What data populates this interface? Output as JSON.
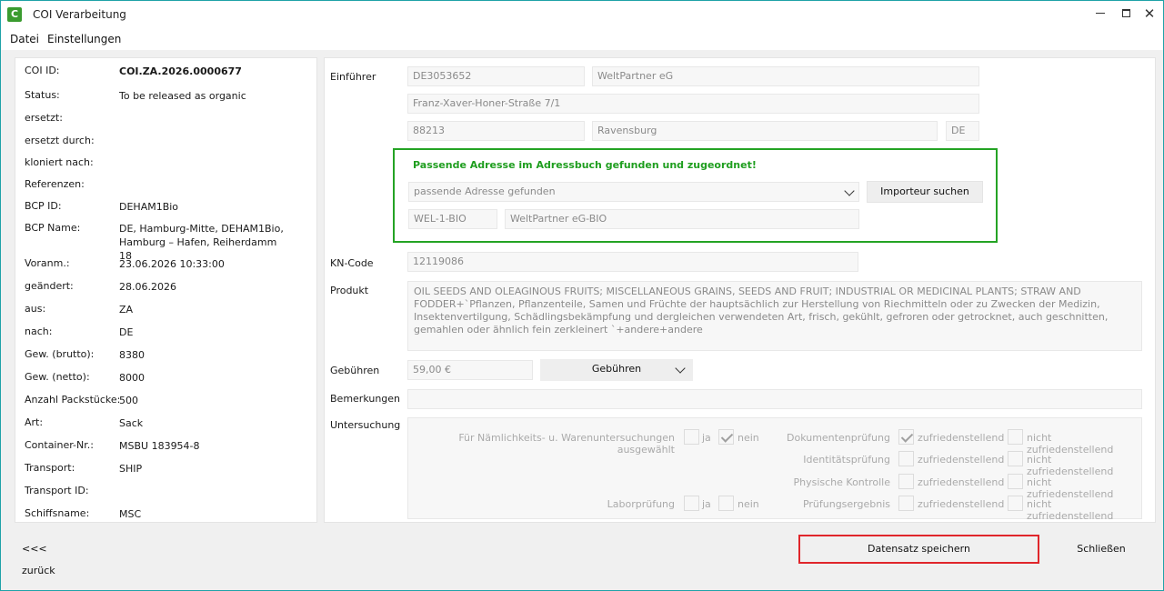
{
  "window": {
    "title": "COI Verarbeitung",
    "icon_letter": "C",
    "minimize": "minimize",
    "maximize": "maximize",
    "close": "✕"
  },
  "menu": {
    "items": [
      "Datei",
      "Einstellungen"
    ]
  },
  "info": {
    "rows": [
      {
        "label": "COI ID:",
        "value": "COI.ZA.2026.0000677"
      },
      {
        "label": "Status:",
        "value": "To be released as organic"
      },
      {
        "label": "ersetzt:",
        "value": ""
      },
      {
        "label": "ersetzt durch:",
        "value": ""
      },
      {
        "label": "kloniert nach:",
        "value": ""
      },
      {
        "label": "Referenzen:",
        "value": ""
      },
      {
        "label": "BCP ID:",
        "value": "DEHAM1Bio"
      },
      {
        "label": "BCP Name:",
        "value": "DE, Hamburg-Mitte, DEHAM1Bio, Hamburg – Hafen, Reiherdamm 18"
      },
      {
        "label": "Voranm.:",
        "value": "23.06.2026 10:33:00"
      },
      {
        "label": "geändert:",
        "value": "28.06.2026"
      },
      {
        "label": "aus:",
        "value": "ZA"
      },
      {
        "label": "nach:",
        "value": "DE"
      },
      {
        "label": "Gew. (brutto):",
        "value": "8380"
      },
      {
        "label": "Gew. (netto):",
        "value": "8000"
      },
      {
        "label": "Anzahl Packstücke:",
        "value": "500"
      },
      {
        "label": "Art:",
        "value": "Sack"
      },
      {
        "label": "Container-Nr.:",
        "value": "MSBU 183954-8"
      },
      {
        "label": "Transport:",
        "value": "SHIP"
      },
      {
        "label": "Transport ID:",
        "value": ""
      },
      {
        "label": "Schiffsname:",
        "value": "MSC"
      }
    ]
  },
  "form": {
    "einfuehrer_label": "Einführer",
    "einfuehrer_id": "DE3053652",
    "einfuehrer_name": "WeltPartner eG",
    "street": "Franz-Xaver-Honer-Straße 7/1",
    "zip": "88213",
    "city": "Ravensburg",
    "country": "DE",
    "match_message": "Passende Adresse im Adressbuch gefunden und zugeordnet!",
    "match_select": "passende Adresse gefunden",
    "search_importer_button": "Importeur suchen",
    "address_code": "WEL-1-BIO",
    "address_name": "WeltPartner eG-BIO",
    "kn_label": "KN-Code",
    "kn_code": "12119086",
    "produkt_label": "Produkt",
    "produkt_text": "OIL SEEDS AND OLEAGINOUS FRUITS; MISCELLANEOUS GRAINS, SEEDS AND FRUIT; INDUSTRIAL OR MEDICINAL PLANTS; STRAW AND FODDER+`Pflanzen, Pflanzenteile, Samen und Früchte der hauptsächlich zur Herstellung von Riechmitteln oder zu Zwecken der Medizin, Insektenvertilgung, Schädlingsbekämpfung und dergleichen verwendeten Art, frisch, gekühlt, gefroren oder getrocknet, auch geschnitten, gemahlen oder ähnlich fein zerkleinert    `+andere+andere",
    "gebuehren_label": "Gebühren",
    "gebuehren_value": "59,00 €",
    "gebuehren_select": "Gebühren",
    "bemerkungen_label": "Bemerkungen",
    "bemerkungen_value": "",
    "untersuchung_label": "Untersuchung"
  },
  "untersuchung": {
    "naemlichkeit_label": "Für Nämlichkeits- u. Warenuntersuchungen ausgewählt",
    "laborpruefung_label": "Laborprüfung",
    "ja": "ja",
    "nein": "nein",
    "dokumentenpruefung_label": "Dokumentenprüfung",
    "identitaetspruefung_label": "Identitätsprüfung",
    "physische_kontrolle_label": "Physische Kontrolle",
    "pruefungsergebnis_label": "Prüfungsergebnis",
    "zufriedenstellend": "zufriedenstellend",
    "nicht_zufriedenstellend": "nicht zufriedenstellend"
  },
  "footer": {
    "back_label": "<<<  zurück",
    "save_label": "Datensatz speichern",
    "close_label": "Schließen"
  }
}
